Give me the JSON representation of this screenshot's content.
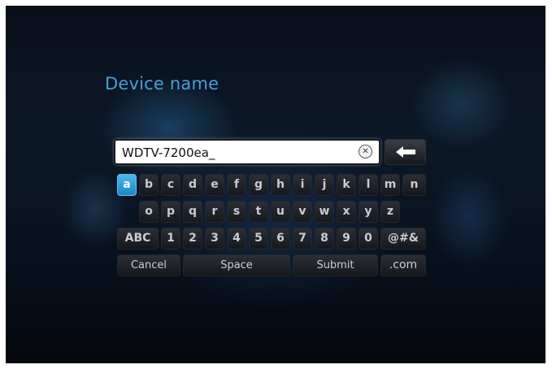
{
  "title": "Device name",
  "input": {
    "value": "WDTV-7200ea_"
  },
  "icons": {
    "clear": "clear-circle-x-icon",
    "backspace": "backspace-arrow-icon"
  },
  "keyboard": {
    "row1": [
      "a",
      "b",
      "c",
      "d",
      "e",
      "f",
      "g",
      "h",
      "i",
      "j",
      "k",
      "l",
      "m",
      "n"
    ],
    "row2": [
      "o",
      "p",
      "q",
      "r",
      "s",
      "t",
      "u",
      "v",
      "w",
      "x",
      "y",
      "z"
    ],
    "row3": [
      "ABC",
      "1",
      "2",
      "3",
      "4",
      "5",
      "6",
      "7",
      "8",
      "9",
      "0",
      "@#&"
    ],
    "row4": [
      "Cancel",
      "Space",
      "Submit",
      ".com"
    ],
    "selected": "a"
  },
  "colors": {
    "accent": "#2a9ee0",
    "title": "#4a9fd6"
  }
}
